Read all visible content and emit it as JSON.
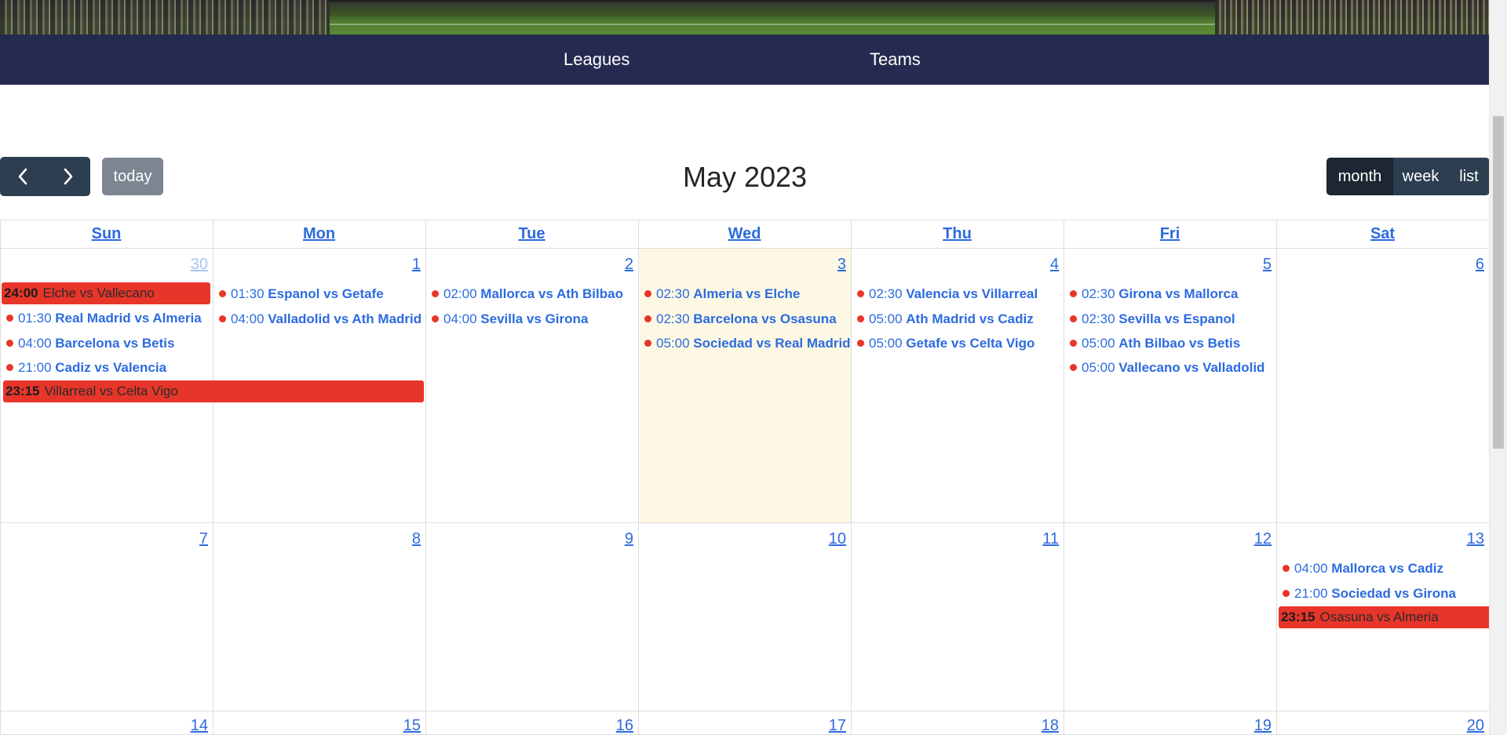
{
  "nav": {
    "leagues": "Leagues",
    "teams": "Teams"
  },
  "toolbar": {
    "title": "May 2023",
    "today": "today",
    "prev_icon": "‹",
    "next_icon": "›",
    "views": [
      "month",
      "week",
      "list"
    ],
    "active_view": "month"
  },
  "days_of_week": [
    "Sun",
    "Mon",
    "Tue",
    "Wed",
    "Thu",
    "Fri",
    "Sat"
  ],
  "weeks": [
    [
      "30",
      "1",
      "2",
      "3",
      "4",
      "5",
      "6"
    ],
    [
      "7",
      "8",
      "9",
      "10",
      "11",
      "12",
      "13"
    ],
    [
      "14",
      "15",
      "16",
      "17",
      "18",
      "19",
      "20"
    ]
  ],
  "events": {
    "sun30_bar": {
      "time": "24:00",
      "title": "Elche vs Vallecano"
    },
    "sun30": [
      {
        "time": "01:30",
        "title": "Real Madrid vs Almeria"
      },
      {
        "time": "04:00",
        "title": "Barcelona vs Betis"
      },
      {
        "time": "21:00",
        "title": "Cadiz vs Valencia"
      }
    ],
    "sun30_span": {
      "time": "23:15",
      "title": "Villarreal vs Celta Vigo"
    },
    "mon1": [
      {
        "time": "01:30",
        "title": "Espanol vs Getafe"
      },
      {
        "time": "04:00",
        "title": "Valladolid vs Ath Madrid"
      }
    ],
    "tue2": [
      {
        "time": "02:00",
        "title": "Mallorca vs Ath Bilbao"
      },
      {
        "time": "04:00",
        "title": "Sevilla vs Girona"
      }
    ],
    "wed3": [
      {
        "time": "02:30",
        "title": "Almeria vs Elche"
      },
      {
        "time": "02:30",
        "title": "Barcelona vs Osasuna"
      },
      {
        "time": "05:00",
        "title": "Sociedad vs Real Madrid"
      }
    ],
    "thu4": [
      {
        "time": "02:30",
        "title": "Valencia vs Villarreal"
      },
      {
        "time": "05:00",
        "title": "Ath Madrid vs Cadiz"
      },
      {
        "time": "05:00",
        "title": "Getafe vs Celta Vigo"
      }
    ],
    "fri5": [
      {
        "time": "02:30",
        "title": "Girona vs Mallorca"
      },
      {
        "time": "02:30",
        "title": "Sevilla vs Espanol"
      },
      {
        "time": "05:00",
        "title": "Ath Bilbao vs Betis"
      },
      {
        "time": "05:00",
        "title": "Vallecano vs Valladolid"
      }
    ],
    "sat13": [
      {
        "time": "04:00",
        "title": "Mallorca vs Cadiz"
      },
      {
        "time": "21:00",
        "title": "Sociedad vs Girona"
      }
    ],
    "sat13_bar": {
      "time": "23:15",
      "title": "Osasuna vs Almeria"
    }
  },
  "colors": {
    "navbar": "#252b50",
    "button_dark": "#2c3e50",
    "today_button": "#7c8591",
    "link": "#2c6bdf",
    "event_red": "#e8352a",
    "today_cell": "#fdf8e4"
  }
}
